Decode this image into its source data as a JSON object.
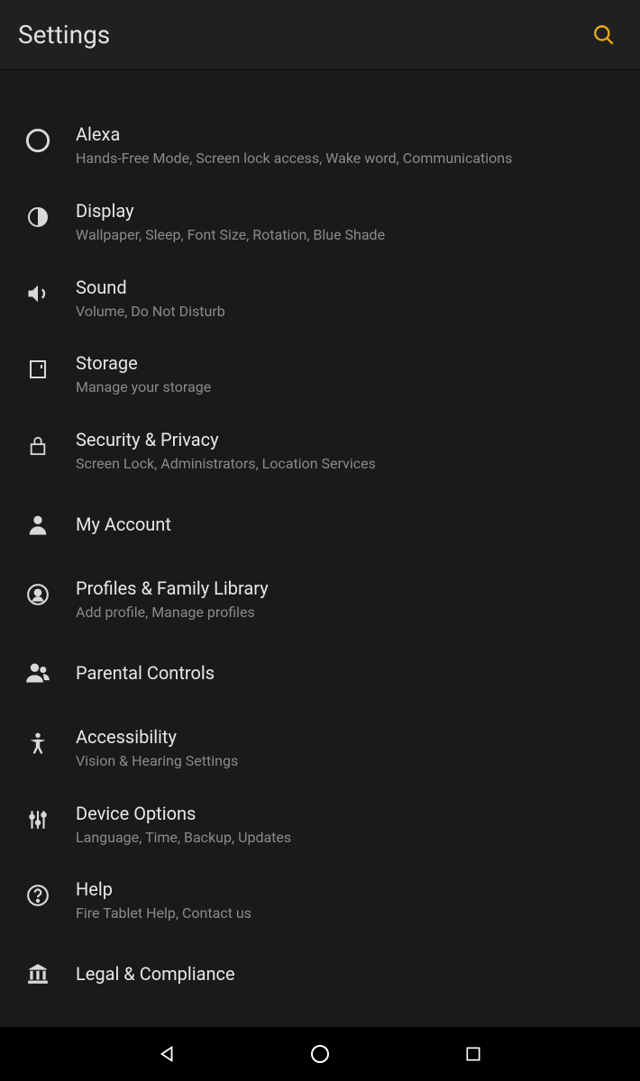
{
  "header": {
    "title": "Settings"
  },
  "items": [
    {
      "icon": "alexa",
      "title": "Alexa",
      "subtitle": "Hands-Free Mode, Screen lock access, Wake word, Communications"
    },
    {
      "icon": "display",
      "title": "Display",
      "subtitle": "Wallpaper, Sleep, Font Size, Rotation, Blue Shade"
    },
    {
      "icon": "sound",
      "title": "Sound",
      "subtitle": "Volume, Do Not Disturb"
    },
    {
      "icon": "storage",
      "title": "Storage",
      "subtitle": "Manage your storage"
    },
    {
      "icon": "security",
      "title": "Security & Privacy",
      "subtitle": "Screen Lock, Administrators, Location Services"
    },
    {
      "icon": "account",
      "title": "My Account",
      "subtitle": ""
    },
    {
      "icon": "profiles",
      "title": "Profiles & Family Library",
      "subtitle": "Add profile, Manage profiles"
    },
    {
      "icon": "parental",
      "title": "Parental Controls",
      "subtitle": ""
    },
    {
      "icon": "accessibility",
      "title": "Accessibility",
      "subtitle": "Vision & Hearing Settings"
    },
    {
      "icon": "device",
      "title": "Device Options",
      "subtitle": "Language, Time, Backup, Updates"
    },
    {
      "icon": "help",
      "title": "Help",
      "subtitle": "Fire Tablet Help, Contact us"
    },
    {
      "icon": "legal",
      "title": "Legal & Compliance",
      "subtitle": ""
    }
  ]
}
